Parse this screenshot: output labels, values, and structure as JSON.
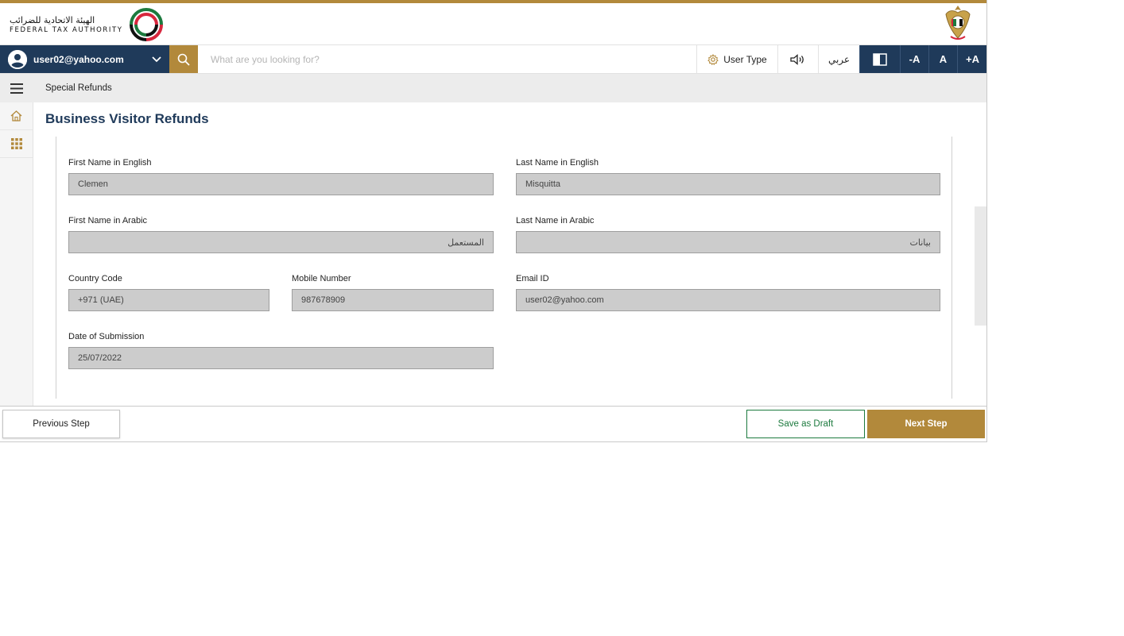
{
  "header": {
    "logo_ar": "الهيئة الاتحادية للضرائب",
    "logo_en": "FEDERAL TAX AUTHORITY",
    "logo_icon": "fta-logo-icon",
    "emblem_icon": "uae-emblem-icon"
  },
  "navbar": {
    "user_email": "user02@yahoo.com",
    "search_placeholder": "What are you looking for?",
    "user_type": "User Type",
    "language": "عربي",
    "font_decrease": "-A",
    "font_reset": "A",
    "font_increase": "+A"
  },
  "breadcrumb": {
    "current": "Special Refunds"
  },
  "page": {
    "title": "Business Visitor Refunds"
  },
  "form": {
    "first_name_en": {
      "label": "First Name in English",
      "value": "Clemen"
    },
    "last_name_en": {
      "label": "Last Name in English",
      "value": "Misquitta"
    },
    "first_name_ar": {
      "label": "First Name in Arabic",
      "value": "المستعمل"
    },
    "last_name_ar": {
      "label": "Last Name in Arabic",
      "value": "بيانات"
    },
    "country_code": {
      "label": "Country Code",
      "value": "+971 (UAE)"
    },
    "mobile": {
      "label": "Mobile Number",
      "value": "987678909"
    },
    "email": {
      "label": "Email ID",
      "value": "user02@yahoo.com"
    },
    "submission_date": {
      "label": "Date of Submission",
      "value": "25/07/2022"
    }
  },
  "footer": {
    "previous": "Previous Step",
    "save_draft": "Save as Draft",
    "next": "Next Step"
  },
  "colors": {
    "gold": "#b2893b",
    "navy": "#1f3a5a",
    "draft_green": "#1c7a3e",
    "field_gray": "#cccccc"
  }
}
